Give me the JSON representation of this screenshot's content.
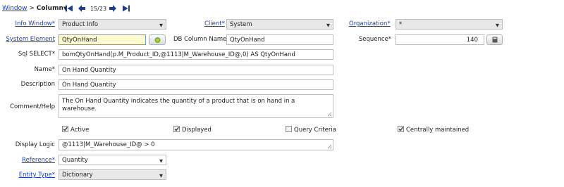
{
  "nav": {
    "window_link": "Window",
    "separator": ">",
    "current": "Column",
    "record_position": "15/23"
  },
  "form": {
    "info_window": {
      "label": "Info Window",
      "value": "Product Info"
    },
    "client": {
      "label": "Client",
      "value": "System"
    },
    "organization": {
      "label": "Organization",
      "value": "*"
    },
    "system_element": {
      "label": "System Element",
      "value": "QtyOnHand"
    },
    "db_column_name": {
      "label": "DB Column Name",
      "value": "QtyOnHand"
    },
    "sequence": {
      "label": "Sequence",
      "value": "140"
    },
    "sql_select": {
      "label": "Sql SELECT",
      "value": "bomQtyOnHand(p.M_Product_ID,@1113|M_Warehouse_ID@,0) AS QtyOnHand"
    },
    "name": {
      "label": "Name",
      "value": "On Hand Quantity"
    },
    "description": {
      "label": "Description",
      "value": "On Hand Quantity"
    },
    "comment_help": {
      "label": "Comment/Help",
      "value": "The On Hand Quantity indicates the quantity of a product that is on hand in a warehouse."
    },
    "checkboxes": [
      {
        "label": "Active",
        "checked": true
      },
      {
        "label": "Displayed",
        "checked": true
      },
      {
        "label": "Query Criteria",
        "checked": false
      },
      {
        "label": "Centrally maintained",
        "checked": true
      }
    ],
    "display_logic": {
      "label": "Display Logic",
      "value": "@1113|M_Warehouse_ID@ > 0"
    },
    "reference": {
      "label": "Reference",
      "value": "Quantity"
    },
    "entity_type": {
      "label": "Entity Type",
      "value": "Dictionary"
    },
    "required_marker": "*"
  },
  "colors": {
    "link": "#1a3fb8",
    "nav_icon": "#1f3d8a",
    "readonly_bg": "#e8e8e8",
    "focus_bg": "#fffbd0"
  }
}
